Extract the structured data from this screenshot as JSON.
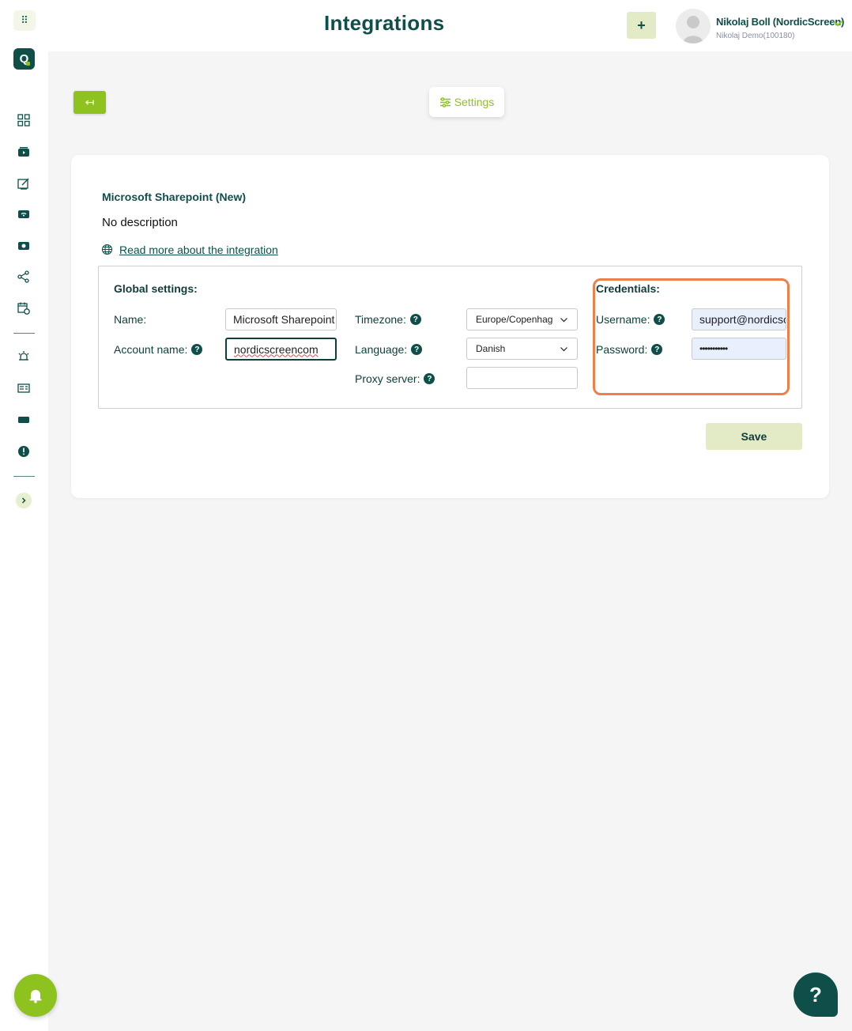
{
  "header": {
    "title": "Integrations",
    "add_label": "+",
    "user_name": "Nikolaj Boll (NordicScreen)",
    "user_sub": "Nikolaj Demo(100180)"
  },
  "sidebar": {
    "apps_glyph": "⠿",
    "logo_letter": "Q",
    "items": [
      {
        "icon": "dashboard-icon"
      },
      {
        "icon": "media-icon"
      },
      {
        "icon": "design-icon"
      },
      {
        "icon": "screens-icon"
      },
      {
        "icon": "playlist-icon"
      },
      {
        "icon": "share-icon"
      },
      {
        "icon": "schedule-icon"
      },
      {
        "icon": "alarm-icon"
      },
      {
        "icon": "news-icon"
      },
      {
        "icon": "display-icon"
      },
      {
        "icon": "alert-icon"
      }
    ]
  },
  "toolbar": {
    "back_glyph": "↤",
    "settings_label": "Settings"
  },
  "integration": {
    "title": "Microsoft Sharepoint (New)",
    "description": "No description",
    "read_more": "Read more about the integration"
  },
  "global_settings": {
    "heading": "Global settings:",
    "name_label": "Name:",
    "name_value": "Microsoft Sharepoint",
    "account_label": "Account name:",
    "account_value": "nordicscreencom",
    "timezone_label": "Timezone:",
    "timezone_value": "Europe/Copenhagen",
    "language_label": "Language:",
    "language_value": "Danish",
    "proxy_label": "Proxy server:",
    "proxy_value": ""
  },
  "credentials": {
    "heading": "Credentials:",
    "username_label": "Username:",
    "username_value": "support@nordicscreen",
    "password_label": "Password:",
    "password_value": "•••••••••••"
  },
  "actions": {
    "save_label": "Save",
    "help_fab": "?"
  },
  "colors": {
    "brand_dark": "#0f4f4a",
    "accent_green": "#8dc21f",
    "highlight_orange": "#ee7f4b"
  }
}
